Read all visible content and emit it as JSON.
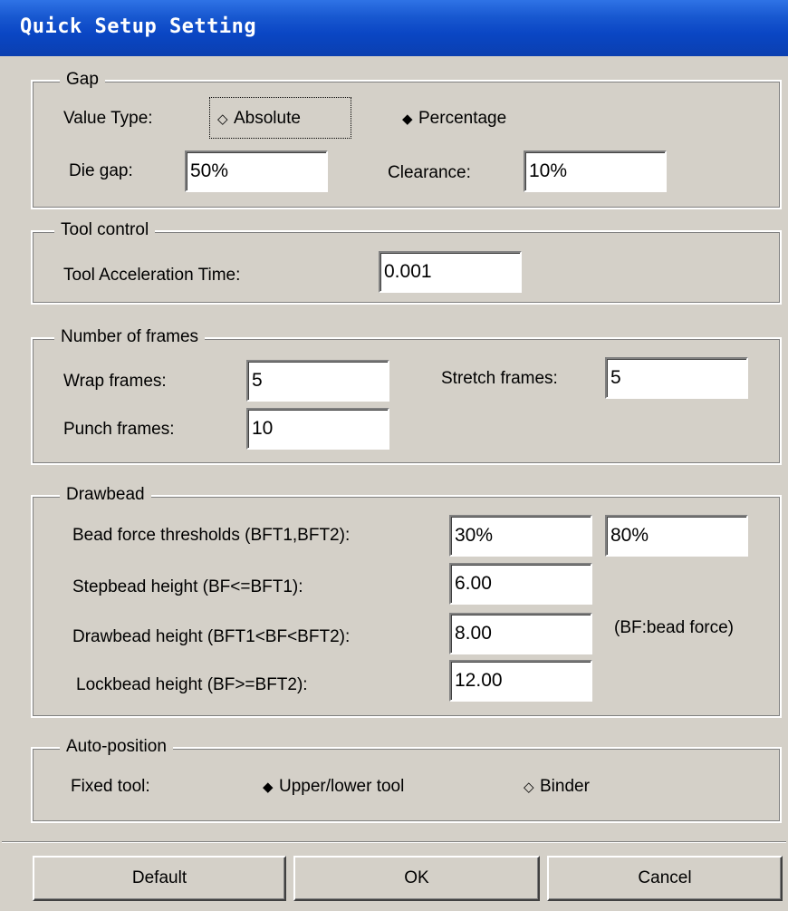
{
  "window": {
    "title": "Quick Setup Setting"
  },
  "gap": {
    "legend": "Gap",
    "value_type_label": "Value Type:",
    "options": [
      {
        "label": "Absolute",
        "selected": false
      },
      {
        "label": "Percentage",
        "selected": true
      }
    ],
    "die_gap_label": "Die gap:",
    "die_gap_value": "50%",
    "clearance_label": "Clearance:",
    "clearance_value": "10%"
  },
  "tool_control": {
    "legend": "Tool control",
    "accel_label": "Tool Acceleration Time:",
    "accel_value": "0.001"
  },
  "frames": {
    "legend": "Number of frames",
    "wrap_label": "Wrap frames:",
    "wrap_value": "5",
    "stretch_label": "Stretch frames:",
    "stretch_value": "5",
    "punch_label": "Punch frames:",
    "punch_value": "10"
  },
  "drawbead": {
    "legend": "Drawbead",
    "bft_label": "Bead force thresholds (BFT1,BFT2):",
    "bft1_value": "30%",
    "bft2_value": "80%",
    "stepbead_label": "Stepbead height (BF<=BFT1):",
    "stepbead_value": "6.00",
    "drawbead_label": "Drawbead height (BFT1<BF<BFT2):",
    "drawbead_value": "8.00",
    "note": "(BF:bead force)",
    "lockbead_label": "Lockbead height (BF>=BFT2):",
    "lockbead_value": "12.00"
  },
  "auto_position": {
    "legend": "Auto-position",
    "fixed_tool_label": "Fixed tool:",
    "options": [
      {
        "label": "Upper/lower tool",
        "selected": true
      },
      {
        "label": "Binder",
        "selected": false
      }
    ]
  },
  "buttons": {
    "default": "Default",
    "ok": "OK",
    "cancel": "Cancel"
  },
  "icons": {
    "radio_selected": "filled-diamond",
    "radio_unselected": "hollow-diamond"
  },
  "colors": {
    "titlebar": "#0a46c4",
    "face": "#d4d0c8"
  }
}
